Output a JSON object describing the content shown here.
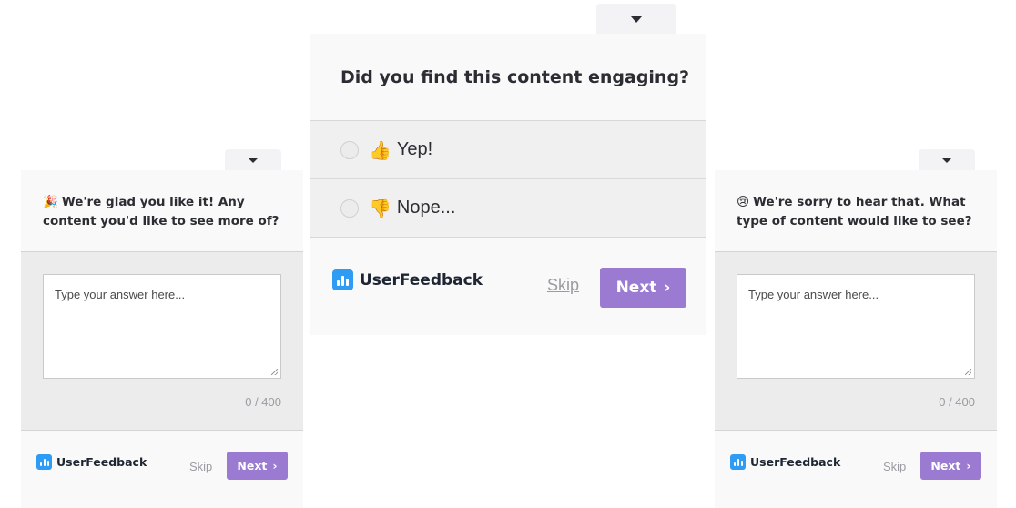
{
  "center": {
    "question": "Did you find this content engaging?",
    "options": [
      {
        "emoji": "👍",
        "label": "Yep!"
      },
      {
        "emoji": "👎",
        "label": "Nope..."
      }
    ],
    "brand": "UserFeedback",
    "skip": "Skip",
    "next": "Next",
    "next_chevron": "›"
  },
  "left": {
    "emoji": "🎉",
    "question": "We're glad you like it! Any content you'd like to see more of?",
    "placeholder": "Type your answer here...",
    "counter": "0 / 400",
    "brand": "UserFeedback",
    "skip": "Skip",
    "next": "Next",
    "next_chevron": "›"
  },
  "right": {
    "emoji": "😢",
    "question": "We're sorry to hear that. What type of content would like to see?",
    "placeholder": "Type your answer here...",
    "counter": "0 / 400",
    "brand": "UserFeedback",
    "skip": "Skip",
    "next": "Next",
    "next_chevron": "›"
  },
  "colors": {
    "accent": "#9a7bd1",
    "brand_icon": "#2e9cf4",
    "panel": "#f9f9f9",
    "option_bg": "#f0f0f0"
  },
  "icons": [
    "chevron-down-icon",
    "thumbs-up-icon",
    "thumbs-down-icon",
    "party-popper-icon",
    "crying-face-icon",
    "userfeedback-logo-icon"
  ]
}
